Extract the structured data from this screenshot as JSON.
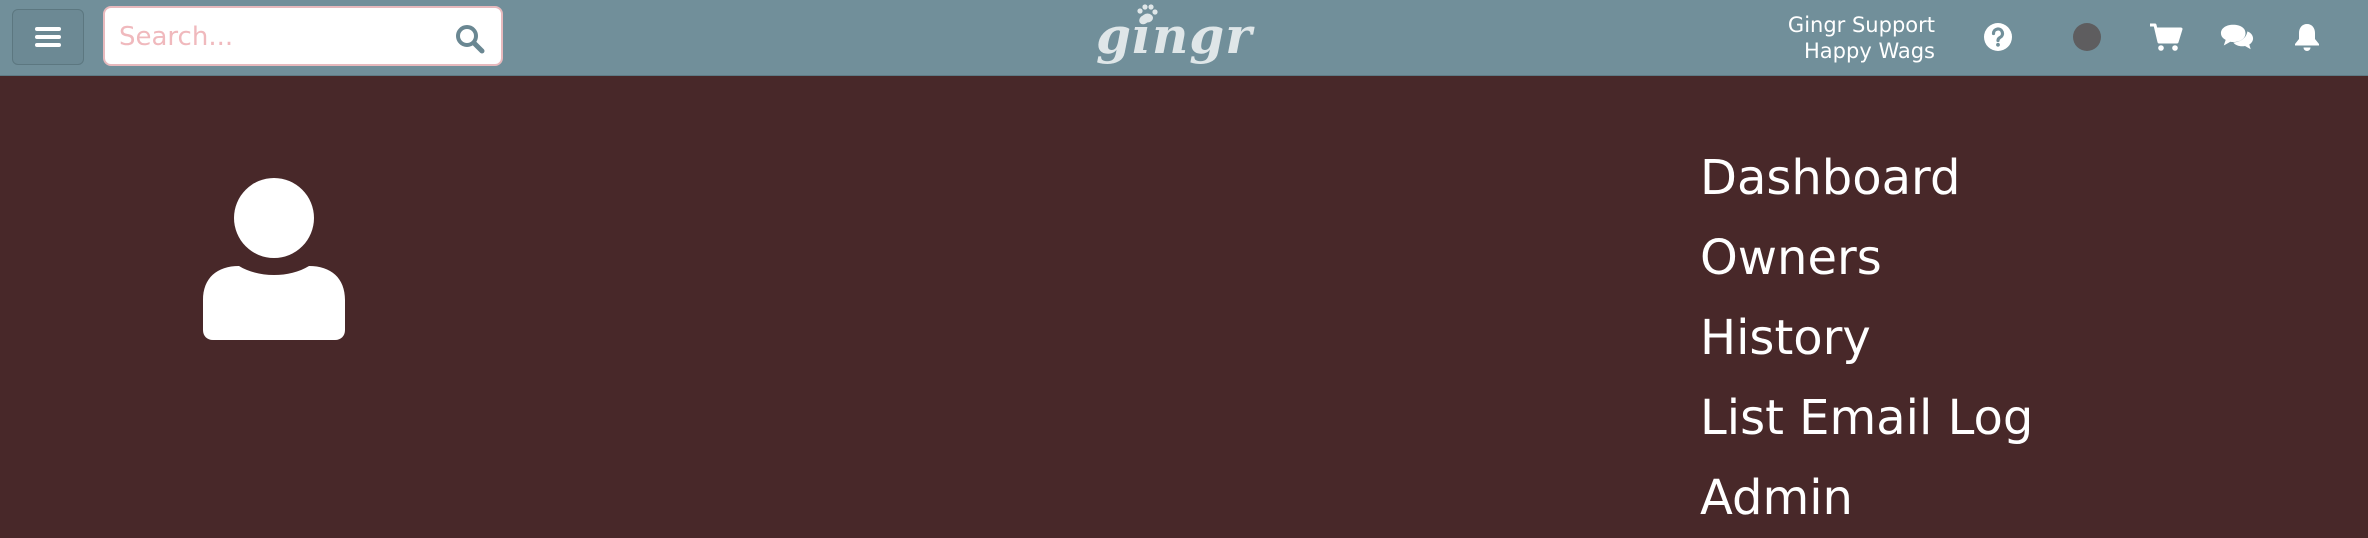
{
  "header": {
    "search": {
      "placeholder": "Search...",
      "value": ""
    },
    "logo_text": "gingr",
    "user": {
      "name": "Gingr Support",
      "location": "Happy Wags"
    },
    "icons": [
      "menu-icon",
      "search-icon",
      "help-icon",
      "status-dot",
      "cart-icon",
      "chat-icon",
      "bell-icon"
    ],
    "colors": {
      "bar": "#718f9a",
      "background": "#482829",
      "status_dot": "#5e5d5f",
      "search_border": "#e7b9bd"
    }
  },
  "profile": {
    "avatar_icon": "user-icon"
  },
  "nav": {
    "items": [
      {
        "label": "Dashboard"
      },
      {
        "label": "Owners"
      },
      {
        "label": "History"
      },
      {
        "label": "List Email Log"
      },
      {
        "label": "Admin"
      }
    ]
  }
}
